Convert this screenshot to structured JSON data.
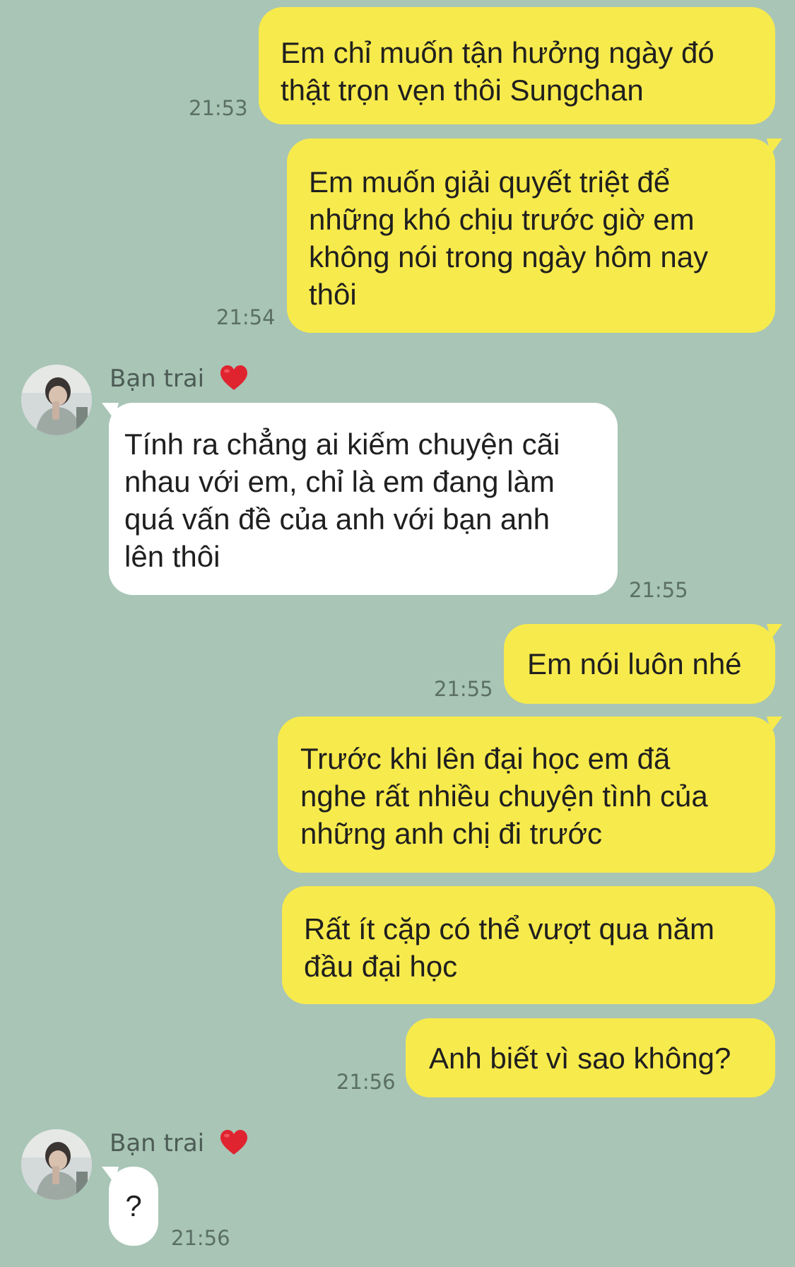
{
  "messages": [
    {
      "id": "m1",
      "direction": "outgoing",
      "text": "Em chỉ muốn tận hưởng ngày đó\nthật trọn vẹn thôi Sungchan",
      "time": "21:53"
    },
    {
      "id": "m2",
      "direction": "outgoing",
      "text": "Em muốn giải quyết triệt để\nnhững khó chịu trước giờ em\nkhông nói trong ngày hôm nay\nthôi",
      "time": "21:54"
    },
    {
      "id": "m3",
      "direction": "incoming",
      "sender": "Bạn trai",
      "text": "Tính ra chẳng ai kiếm chuyện cãi\nnhau với em, chỉ là em đang làm\nquá vấn đề của anh với bạn anh\nlên thôi",
      "time": "21:55"
    },
    {
      "id": "m4",
      "direction": "outgoing",
      "text": "Em nói luôn nhé",
      "time": "21:55"
    },
    {
      "id": "m5",
      "direction": "outgoing",
      "text": "Trước khi lên đại học em đã\nnghe rất nhiều chuyện tình của\nnhững anh chị đi trước",
      "time": ""
    },
    {
      "id": "m6",
      "direction": "outgoing",
      "text": "Rất ít cặp có thể vượt qua năm\nđầu đại học",
      "time": ""
    },
    {
      "id": "m7",
      "direction": "outgoing",
      "text": "Anh biết vì sao không?",
      "time": "21:56"
    },
    {
      "id": "m8",
      "direction": "incoming",
      "sender": "Bạn trai",
      "text": "?",
      "time": "21:56"
    }
  ],
  "contact": {
    "name": "Bạn trai",
    "heart_icon": "red-heart-icon",
    "avatar_icon": "profile-avatar"
  },
  "theme": {
    "background": "#a8c5b6",
    "outgoing_bubble": "#f7ea4c",
    "incoming_bubble": "#ffffff",
    "heart": "#e0242f"
  }
}
